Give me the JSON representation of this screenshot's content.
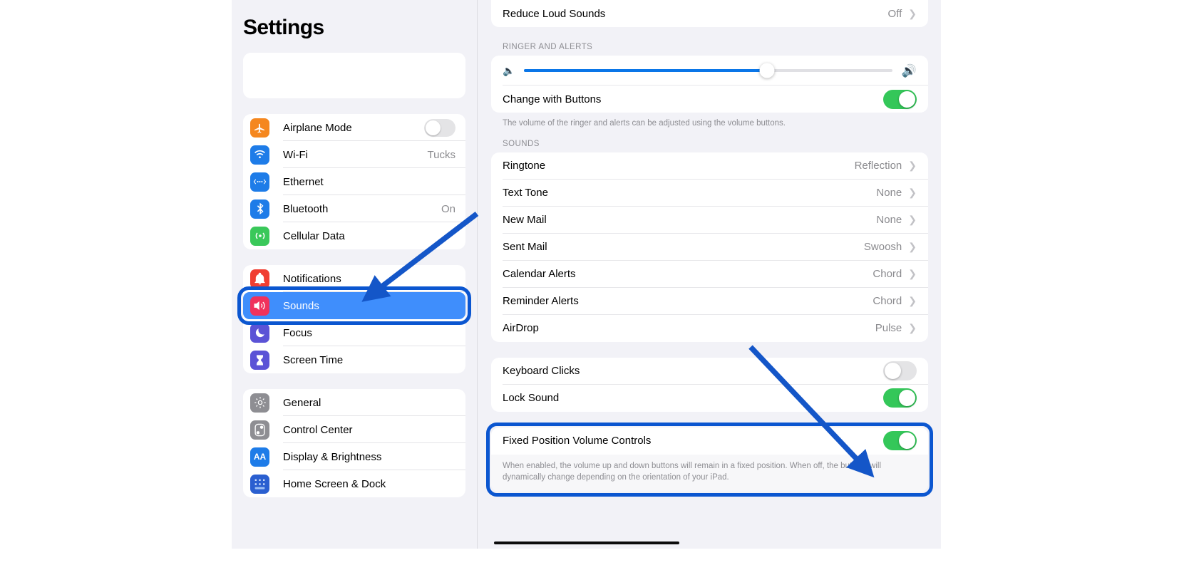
{
  "sidebar": {
    "title": "Settings",
    "search_placeholder": "",
    "groups": [
      {
        "items": [
          {
            "label": "Airplane Mode",
            "icon": "airplane-icon",
            "icon_bg": "#f5871f",
            "glyph": "✈",
            "control": "toggle",
            "toggle_on": false
          },
          {
            "label": "Wi-Fi",
            "icon": "wifi-icon",
            "icon_bg": "#1e7ce8",
            "glyph": "⌁",
            "control": "value",
            "value": "Tucks"
          },
          {
            "label": "Ethernet",
            "icon": "ethernet-icon",
            "icon_bg": "#1e7ce8",
            "glyph": "⟨⋯⟩",
            "control": "none",
            "value": ""
          },
          {
            "label": "Bluetooth",
            "icon": "bluetooth-icon",
            "icon_bg": "#1e7ce8",
            "glyph": "⌁",
            "control": "value",
            "value": "On"
          },
          {
            "label": "Cellular Data",
            "icon": "cellular-icon",
            "icon_bg": "#3ac85a",
            "glyph": "((•))",
            "control": "none",
            "value": ""
          }
        ]
      },
      {
        "items": [
          {
            "label": "Notifications",
            "icon": "bell-icon",
            "icon_bg": "#f03e32",
            "glyph": "🔔",
            "control": "none",
            "value": "",
            "selected": false
          },
          {
            "label": "Sounds",
            "icon": "speaker-icon",
            "icon_bg": "#f0325c",
            "glyph": "🔊",
            "control": "none",
            "value": "",
            "selected": true
          },
          {
            "label": "Focus",
            "icon": "moon-icon",
            "icon_bg": "#5b53d6",
            "glyph": "☾",
            "control": "none",
            "value": "",
            "selected": false
          },
          {
            "label": "Screen Time",
            "icon": "hourglass-icon",
            "icon_bg": "#5b53d6",
            "glyph": "⌛",
            "control": "none",
            "value": "",
            "selected": false
          }
        ]
      },
      {
        "items": [
          {
            "label": "General",
            "icon": "gear-icon",
            "icon_bg": "#8e8e93",
            "glyph": "⚙",
            "control": "none",
            "value": ""
          },
          {
            "label": "Control Center",
            "icon": "control-center-icon",
            "icon_bg": "#8e8e93",
            "glyph": "◍",
            "control": "none",
            "value": ""
          },
          {
            "label": "Display & Brightness",
            "icon": "display-brightness-icon",
            "icon_bg": "#1e7ce8",
            "glyph": "AA",
            "control": "none",
            "value": ""
          },
          {
            "label": "Home Screen & Dock",
            "icon": "home-screen-dock-icon",
            "icon_bg": "#2a5fd0",
            "glyph": "▦",
            "control": "none",
            "value": ""
          }
        ]
      }
    ]
  },
  "content": {
    "reduce_loud_sounds": {
      "label": "Reduce Loud Sounds",
      "value": "Off"
    },
    "ringer_section": {
      "header": "RINGER AND ALERTS",
      "slider": {
        "value_percent": 66,
        "min_icon": "speaker-low-icon",
        "max_icon": "speaker-high-icon"
      },
      "change_with_buttons": {
        "label": "Change with Buttons",
        "on": true
      },
      "footnote": "The volume of the ringer and alerts can be adjusted using the volume buttons."
    },
    "sounds_section": {
      "header": "SOUNDS",
      "rows": [
        {
          "label": "Ringtone",
          "value": "Reflection"
        },
        {
          "label": "Text Tone",
          "value": "None"
        },
        {
          "label": "New Mail",
          "value": "None"
        },
        {
          "label": "Sent Mail",
          "value": "Swoosh"
        },
        {
          "label": "Calendar Alerts",
          "value": "Chord"
        },
        {
          "label": "Reminder Alerts",
          "value": "Chord"
        },
        {
          "label": "AirDrop",
          "value": "Pulse"
        }
      ]
    },
    "clicks_section": {
      "rows": [
        {
          "label": "Keyboard Clicks",
          "on": false
        },
        {
          "label": "Lock Sound",
          "on": true
        }
      ]
    },
    "fixed_position": {
      "label": "Fixed Position Volume Controls",
      "on": true,
      "footnote": "When enabled, the volume up and down buttons will remain in a fixed position. When off, the buttons will dynamically change depending on the orientation of your iPad."
    }
  },
  "annotations": {
    "highlight_color": "#0b56d0",
    "arrow_color": "#1456c8",
    "arrow_1_target": "Sounds",
    "arrow_2_target": "Fixed Position Volume Controls"
  }
}
